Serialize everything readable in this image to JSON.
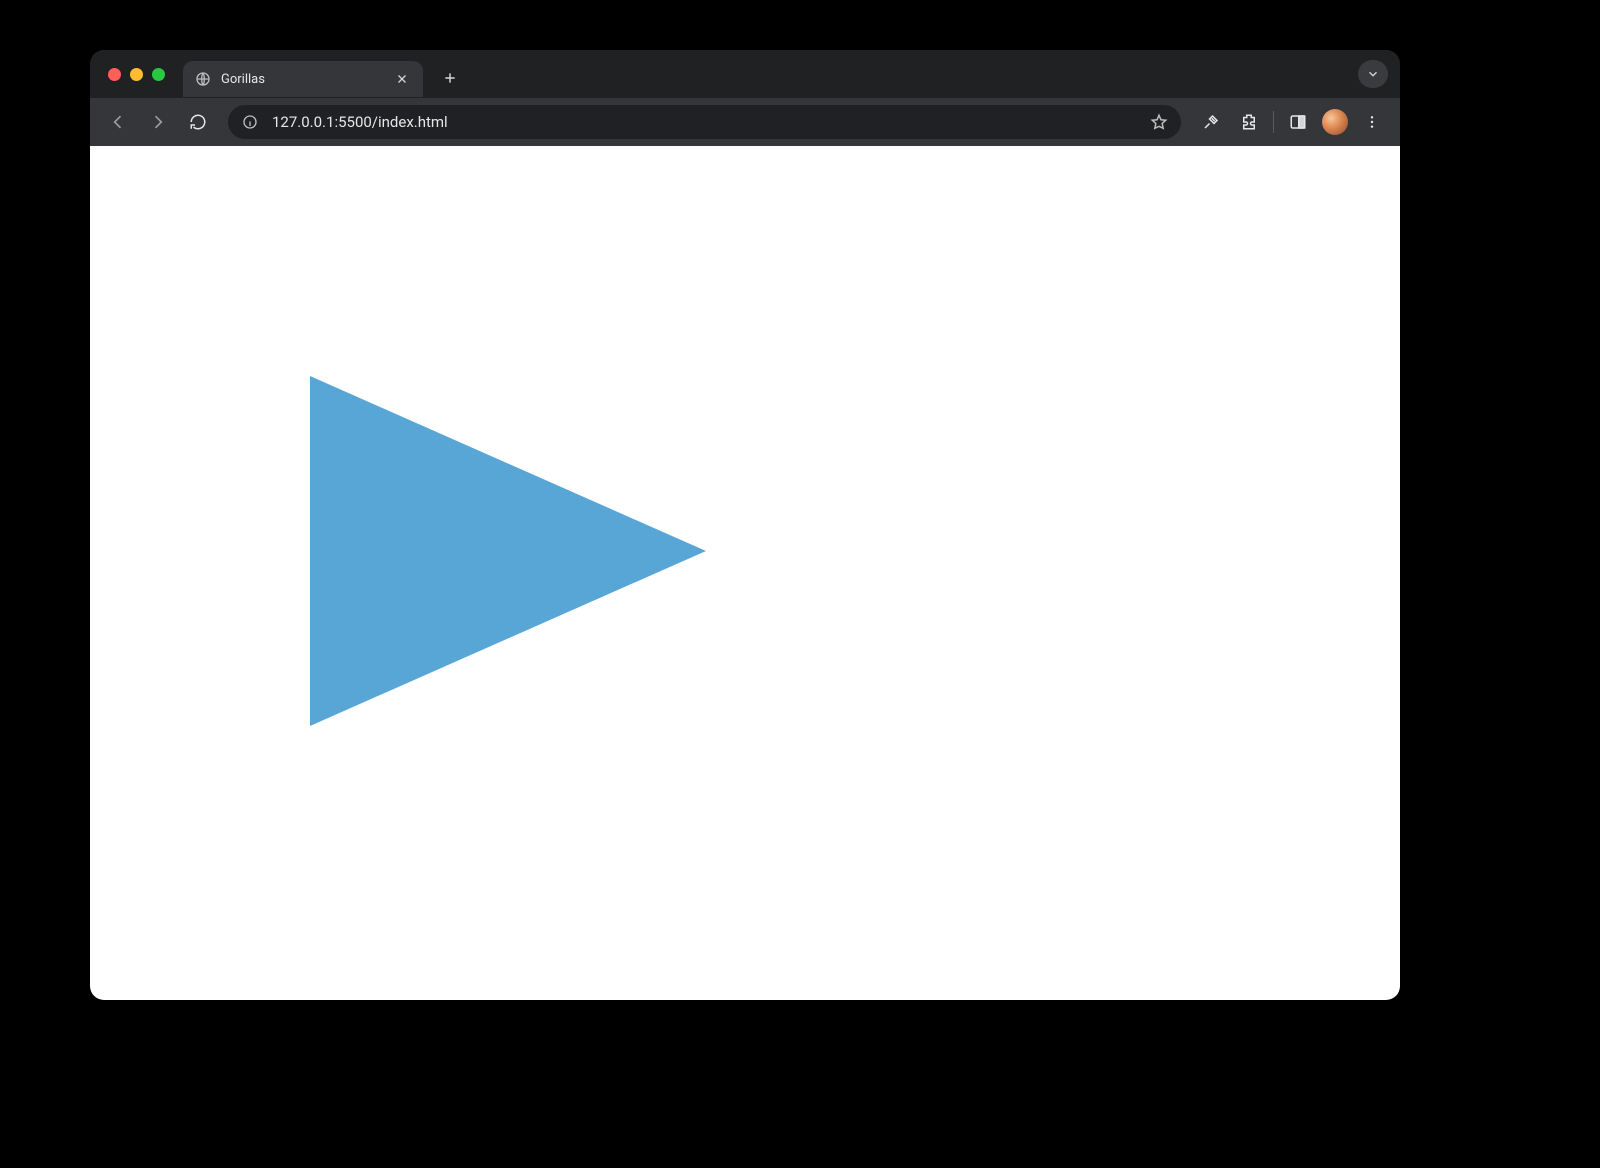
{
  "browser": {
    "tab_title": "Gorillas",
    "url": "127.0.0.1:5500/index.html"
  },
  "page": {
    "triangle_color": "#58a6d6"
  }
}
